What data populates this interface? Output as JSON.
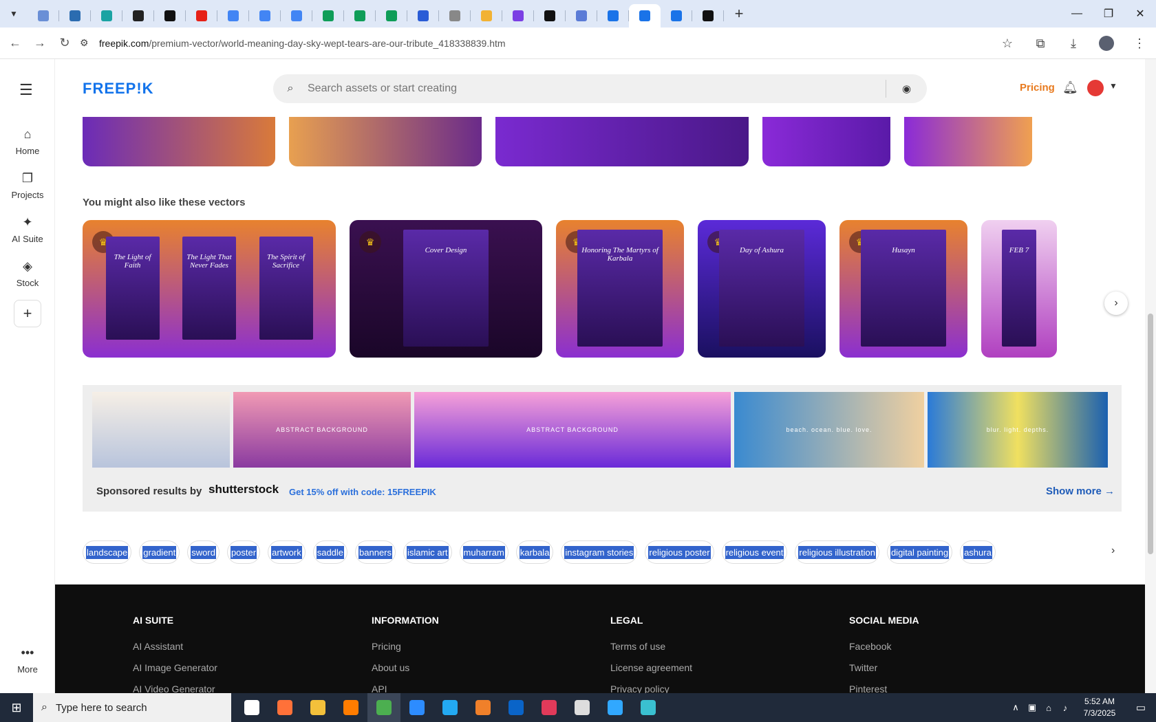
{
  "browser": {
    "url_host": "freepik.com",
    "url_path": "/premium-vector/world-meaning-day-sky-wept-tears-are-our-tribute_418338839.htm",
    "tabs": [
      {
        "color": "#6a8fd6"
      },
      {
        "color": "#2b6cb0"
      },
      {
        "color": "#1aa3a3"
      },
      {
        "color": "#222222"
      },
      {
        "color": "#111111"
      },
      {
        "color": "#e62117"
      },
      {
        "color": "#4285f4"
      },
      {
        "color": "#4285f4"
      },
      {
        "color": "#4285f4"
      },
      {
        "color": "#0f9d58"
      },
      {
        "color": "#0f9d58"
      },
      {
        "color": "#0f9d58"
      },
      {
        "color": "#2a5cd6"
      },
      {
        "color": "#888888"
      },
      {
        "color": "#f2b234"
      },
      {
        "color": "#7b3fe4"
      },
      {
        "color": "#111111"
      },
      {
        "color": "#5b7bd6"
      },
      {
        "color": "#1a73e8"
      },
      {
        "color": "#1a73e8",
        "active": true
      },
      {
        "color": "#1a73e8"
      },
      {
        "color": "#111111"
      }
    ]
  },
  "sidebar": {
    "items": [
      {
        "label": "Home",
        "icon": "home-icon",
        "glyph": "⌂"
      },
      {
        "label": "Projects",
        "icon": "projects-icon",
        "glyph": "❐"
      },
      {
        "label": "AI Suite",
        "icon": "sparkle-icon",
        "glyph": "✦"
      },
      {
        "label": "Stock",
        "icon": "stock-icon",
        "glyph": "◈"
      }
    ],
    "add_glyph": "+",
    "more_label": "More"
  },
  "header": {
    "logo": "FREEP!K",
    "search_placeholder": "Search assets or start creating",
    "pricing": "Pricing"
  },
  "top_cards": [
    {
      "colors": [
        "#6b2bb8",
        "#d97a3a"
      ]
    },
    {
      "colors": [
        "#e8a050",
        "#6a2a8a"
      ]
    },
    {
      "colors": [
        "#7a2ad0",
        "#4a1888"
      ]
    },
    {
      "colors": [
        "#8a2ad8",
        "#5a1aa8"
      ]
    },
    {
      "colors": [
        "#8a2ad8",
        "#f0a050"
      ]
    }
  ],
  "section_title": "You might also like these vectors",
  "vectors": [
    {
      "colors": [
        "#e8822e",
        "#8b2fd0"
      ],
      "posters": [
        "The Light of Faith",
        "The Light That Never Fades",
        "The Spirit of Sacrifice"
      ]
    },
    {
      "colors": [
        "#3a1050",
        "#1a0628"
      ],
      "posters": [
        "Cover Design"
      ]
    },
    {
      "colors": [
        "#e8822e",
        "#8b2fd0"
      ],
      "posters": [
        "Honoring The Martyrs of Karbala"
      ]
    },
    {
      "colors": [
        "#5b2ad8",
        "#1a1060"
      ],
      "posters": [
        "Day of Ashura"
      ]
    },
    {
      "colors": [
        "#e8822e",
        "#8b2fd0"
      ],
      "posters": [
        "Husayn"
      ]
    },
    {
      "colors": [
        "#f0d0f0",
        "#b040c0"
      ],
      "posters": [
        "FEB 7"
      ]
    }
  ],
  "sponsored": {
    "label": "Sponsored results by",
    "brand": "shutterstock",
    "offer": "Get 15% off with code: 15FREEPIK",
    "show_more": "Show more →",
    "images": [
      {
        "text": "",
        "bg": "linear-gradient(#f6efe6,#b8c4dc)"
      },
      {
        "text": "ABSTRACT BACKGROUND",
        "bg": "linear-gradient(#f19ab4,#8a3aa0)"
      },
      {
        "text": "ABSTRACT BACKGROUND",
        "bg": "linear-gradient(#f7a1d8,#6a2ad8)"
      },
      {
        "text": "beach.  ocean.  blue.  love.",
        "bg": "linear-gradient(90deg,#3a8ad0,#f0d0a0)"
      },
      {
        "text": "blur.  light.  depths.",
        "bg": "linear-gradient(90deg,#2a7ad8,#f0e060,#1a60b0)"
      }
    ]
  },
  "tags": [
    "landscape",
    "gradient",
    "sword",
    "poster",
    "artwork",
    "saddle",
    "banners",
    "islamic art",
    "muharram",
    "karbala",
    "instagram stories",
    "religious poster",
    "religious event",
    "religious illustration",
    "digital painting",
    "ashura"
  ],
  "footer": {
    "columns": [
      {
        "title": "AI SUITE",
        "links": [
          "AI Assistant",
          "AI Image Generator",
          "AI Video Generator"
        ]
      },
      {
        "title": "INFORMATION",
        "links": [
          "Pricing",
          "About us",
          "API"
        ]
      },
      {
        "title": "LEGAL",
        "links": [
          "Terms of use",
          "License agreement",
          "Privacy policy"
        ]
      },
      {
        "title": "SOCIAL MEDIA",
        "links": [
          "Facebook",
          "Twitter",
          "Pinterest"
        ]
      }
    ]
  },
  "taskbar": {
    "search_placeholder": "Type here to search",
    "apps": [
      {
        "name": "task-view",
        "color": "#ffffff"
      },
      {
        "name": "firefox",
        "color": "#ff7139"
      },
      {
        "name": "file-explorer",
        "color": "#f3c03b"
      },
      {
        "name": "illustrator",
        "color": "#ff7c00"
      },
      {
        "name": "chrome",
        "color": "#4caf50",
        "active": true
      },
      {
        "name": "zoom",
        "color": "#2d8cff"
      },
      {
        "name": "vscode",
        "color": "#23a9f2"
      },
      {
        "name": "app-orange",
        "color": "#f0802a"
      },
      {
        "name": "outlook",
        "color": "#0a64c8"
      },
      {
        "name": "creative-cloud",
        "color": "#e03a5a"
      },
      {
        "name": "pen-tool",
        "color": "#dddddd"
      },
      {
        "name": "photoshop",
        "color": "#31a8ff"
      },
      {
        "name": "app-gem",
        "color": "#3ac0d0"
      }
    ],
    "time": "5:52 AM",
    "date": "7/3/2025"
  }
}
